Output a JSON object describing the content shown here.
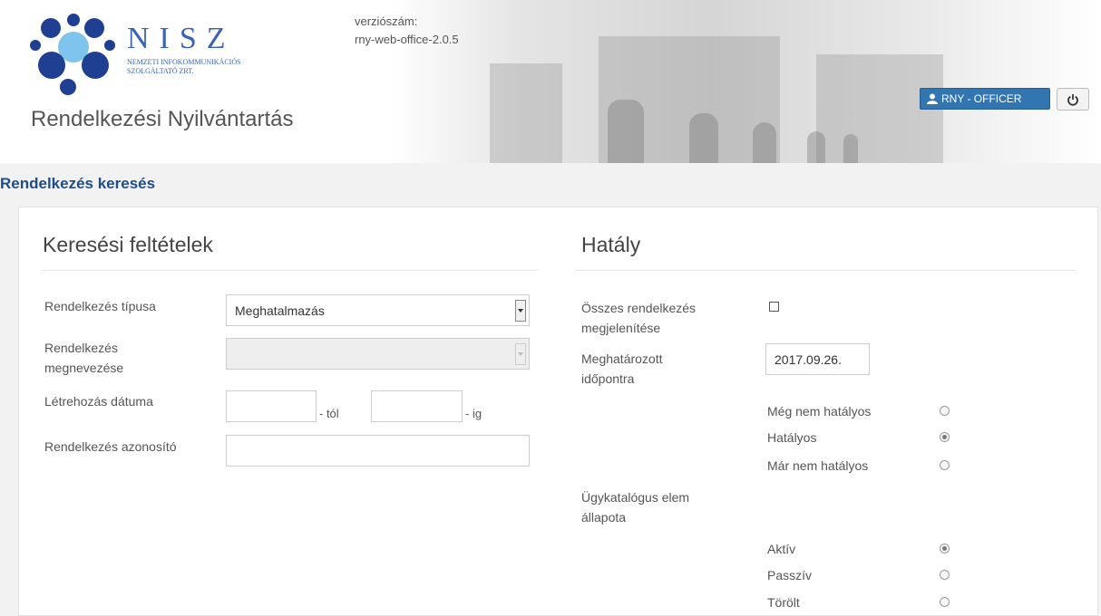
{
  "header": {
    "logo_text": "NISZ",
    "logo_subtitle_line1": "NEMZETI INFOKOMMUNIKÁCIÓS",
    "logo_subtitle_line2": "SZOLGÁLTATÓ ZRT.",
    "app_title": "Rendelkezési Nyilvántartás",
    "version_label": "verziószám:",
    "version_value": "rny-web-office-2.0.5",
    "user_button_label": "RNY - OFFICER",
    "icons": {
      "user": "user-icon",
      "logout": "power-icon"
    }
  },
  "page_title": "Rendelkezés keresés",
  "search": {
    "title": "Keresési feltételek",
    "type_label": "Rendelkezés típusa",
    "type_value": "Meghatalmazás",
    "name_label": "Rendelkezés megnevezése",
    "name_value": "",
    "created_label": "Létrehozás dátuma",
    "from_suffix": "- tól",
    "to_suffix": "- ig",
    "id_label": "Rendelkezés azonosító"
  },
  "effect": {
    "title": "Hatály",
    "all_label": "Összes rendelkezés megjelenítése",
    "date_label": "Meghatározott időpontra",
    "date_value": "2017.09.26.",
    "status_options": [
      {
        "label": "Még nem hatályos",
        "selected": false
      },
      {
        "label": "Hatályos",
        "selected": true
      },
      {
        "label": "Már nem hatályos",
        "selected": false
      }
    ],
    "catalog_label": "Ügykatalógus elem állapota",
    "catalog_options": [
      {
        "label": "Aktív",
        "selected": true
      },
      {
        "label": "Passzív",
        "selected": false
      },
      {
        "label": "Törölt",
        "selected": false
      }
    ]
  }
}
